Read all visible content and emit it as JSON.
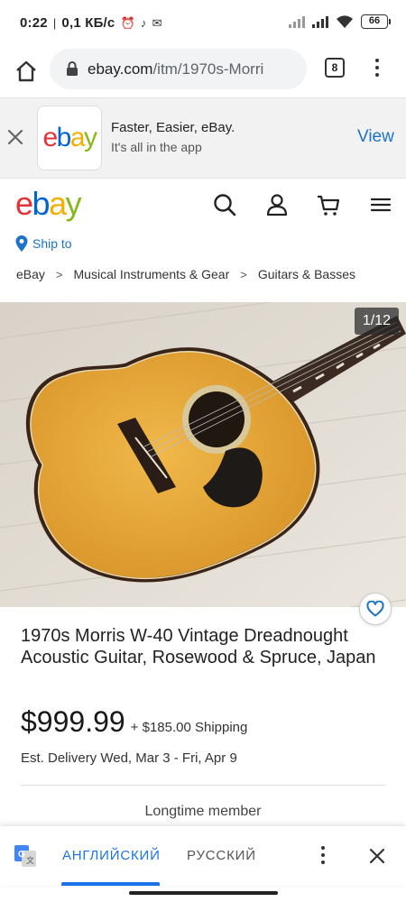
{
  "status_bar": {
    "time": "0:22",
    "network_speed": "0,1 КБ/с",
    "battery": "66"
  },
  "browser": {
    "url_host": "ebay.com",
    "url_path": "/itm/1970s-Morri",
    "tab_count": "8"
  },
  "app_banner": {
    "logo": {
      "e": "e",
      "b": "b",
      "a": "a",
      "y": "y"
    },
    "title": "Faster, Easier, eBay.",
    "subtitle": "It's all in the app",
    "view_label": "View"
  },
  "header": {
    "logo": {
      "e": "e",
      "b": "b",
      "a": "a",
      "y": "y"
    },
    "ship_to": "Ship to"
  },
  "breadcrumb": [
    "eBay",
    "Musical Instruments & Gear",
    "Guitars & Basses"
  ],
  "gallery": {
    "counter": "1/12"
  },
  "item": {
    "title": "1970s Morris W-40 Vintage Dreadnought Acoustic Guitar, Rosewood & Spruce, Japan",
    "price": "$999.99",
    "shipping": "+ $185.00 Shipping",
    "delivery": "Est. Delivery Wed, Mar 3 - Fri, Apr 9",
    "seller_note": "Longtime member"
  },
  "translate_bar": {
    "source_lang": "АНГЛИЙСКИЙ",
    "target_lang": "РУССКИЙ"
  },
  "colors": {
    "ebay_red": "#e53238",
    "ebay_blue": "#0064d2",
    "ebay_yellow": "#f5af02",
    "ebay_green": "#86b817",
    "link_blue": "#1c73c8"
  }
}
